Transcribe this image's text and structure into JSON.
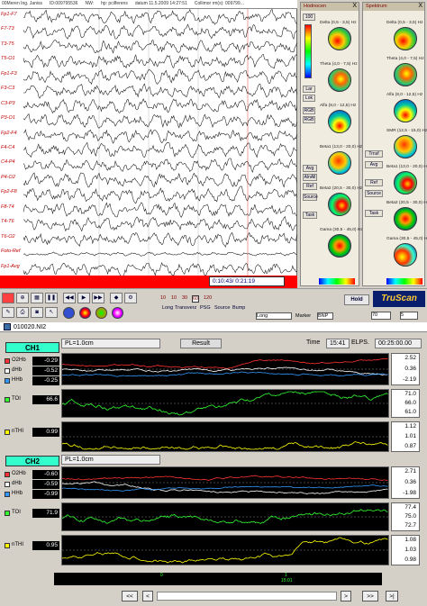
{
  "eeg": {
    "titlebar": [
      "00Meren Ing. Janiss",
      "ID:009795536",
      "NW:",
      "hp: pcilferens",
      "datum 11.5.2009 14:27:51",
      "Collimor rm(s): 009799..."
    ],
    "channels": [
      "Fp1-F7",
      "F7-T3",
      "T3-T5",
      "T5-O1",
      "Fp1-F3",
      "F3-C3",
      "C3-P3",
      "P3-O1",
      "Fp2-F4",
      "F4-C4",
      "C4-P4",
      "P4-O2",
      "Fp2-F8",
      "F8-T4",
      "T4-T6",
      "T6-O2",
      "Foto-Ref",
      "Fp1-Avg"
    ],
    "time_readout": "0:10:43/ 0:21:19",
    "toolbar": {
      "speeds": [
        "10",
        "10",
        "30",
        "60",
        "120"
      ],
      "labels": [
        "Long",
        "Transverz",
        "PSG",
        "Source",
        "Bump"
      ],
      "combo_long": "Long",
      "marker_label": "Marker",
      "hold_button": "Hold",
      "bnp_label": "BNP",
      "truscan_logo": "TruScan",
      "rate": "70",
      "rate2": "5"
    },
    "mapping_panel": {
      "title": "Hodnocen",
      "close": "X",
      "level": "100",
      "bands": [
        "Delta (0,5 - 3,5) Hz",
        "Theta (4,0 - 7,5) Hz",
        "Alfa (8,0 - 12,5) Hz",
        "Beta1 (13,0 - 20,0) Hz",
        "Beta2 (20,5 - 30,0) Hz",
        "Gama (30,5 - 45,0) Hz"
      ],
      "buttons": [
        "Avg",
        "AlnAll",
        "Ref",
        "Source",
        "Task"
      ],
      "options": [
        "Lar",
        "Lok",
        "RGB",
        "RGB"
      ]
    },
    "spectrum_panel": {
      "title": "Spektrum",
      "close": "X",
      "bands": [
        "Delta (0,5 - 3,5) Hz",
        "Theta (4,0 - 7,5) Hz",
        "Alfa (8,0 - 12,5) Hz",
        "SMR (12,5 - 15,0) Hz",
        "Beta1 (13,0 - 20,0) Hz",
        "Beta2 (20,5 - 30,0) Hz",
        "Gama (30,5 - 45,0) Hz"
      ],
      "buttons": [
        "Trnsf",
        "Avg",
        "Ref",
        "Source",
        "Task"
      ]
    }
  },
  "nirs": {
    "window_title": "010020.NI2",
    "result_button": "Result",
    "time_label": "Time",
    "time_value": "15:41",
    "elps_label": "ELPS.",
    "elps_value": "00:25:00.00",
    "channels": [
      {
        "name": "CH1",
        "pl": "PL=1.0cm",
        "rows": [
          {
            "label": "O2Hb",
            "value": "-0.29",
            "color": "#ff3333"
          },
          {
            "label": "dHb",
            "value": "-0.52",
            "color": "#ffffff"
          },
          {
            "label": "HHb",
            "value": "-0.25",
            "color": "#3399ff"
          },
          {
            "label": "TOI",
            "value": "66.6",
            "color": "#33ff33"
          },
          {
            "label": "nTHI",
            "value": "0.99",
            "color": "#ffff00"
          }
        ],
        "hb_axis": [
          "2.52",
          "0.36",
          "-2.19"
        ],
        "toi_axis": [
          "71.0",
          "66.0",
          "61.0"
        ],
        "thi_axis": [
          "1.12",
          "1.01",
          "0.87"
        ]
      },
      {
        "name": "CH2",
        "pl": "PL=1.0cm",
        "rows": [
          {
            "label": "O2Hb",
            "value": "-0.60",
            "color": "#ff3333"
          },
          {
            "label": "dHb",
            "value": "-0.59",
            "color": "#ffffff"
          },
          {
            "label": "HHb",
            "value": "-0.99",
            "color": "#3399ff"
          },
          {
            "label": "TOI",
            "value": "71.9",
            "color": "#33ff33"
          },
          {
            "label": "nTHI",
            "value": "0.95",
            "color": "#ffff00"
          }
        ],
        "hb_axis": [
          "2.71",
          "0.36",
          "-1.98"
        ],
        "toi_axis": [
          "77.4",
          "75.0",
          "72.7"
        ],
        "thi_axis": [
          "1.08",
          "1.03",
          "0.98"
        ]
      }
    ],
    "bottom_markers": [
      "0",
      "1",
      "15:01"
    ],
    "nav": {
      "rewind": "<<",
      "prev": "<",
      "next": ">",
      "forward": ">>",
      "end": ">|"
    }
  },
  "colors": {
    "channel_label": "#c00000",
    "red_bar": "#ff0000",
    "ch_header": "#33ffcc",
    "plot_bg": "#000000"
  }
}
